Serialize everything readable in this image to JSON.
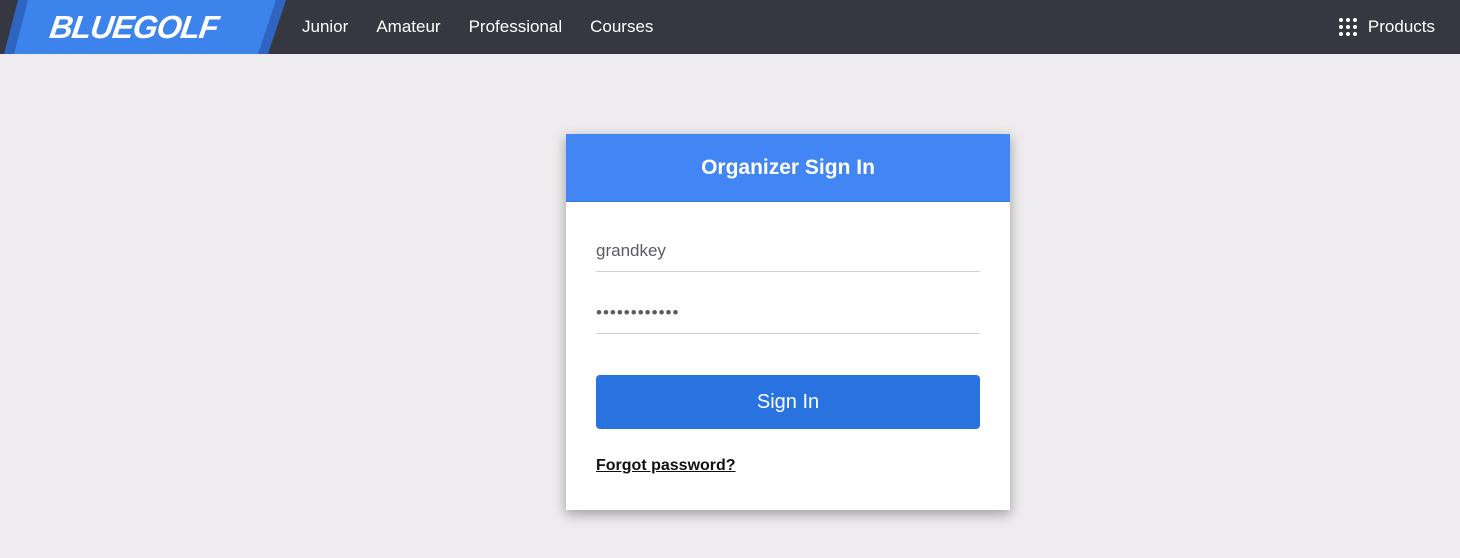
{
  "brand": {
    "name": "BLUEGOLF",
    "accent_color": "#3d83ec",
    "topbar_color": "#353841"
  },
  "nav": {
    "items": [
      {
        "label": "Junior"
      },
      {
        "label": "Amateur"
      },
      {
        "label": "Professional"
      },
      {
        "label": "Courses"
      }
    ],
    "products_label": "Products",
    "products_icon": "grid-icon"
  },
  "signin": {
    "title": "Organizer Sign In",
    "header_color": "#4285f4",
    "username_value": "grandkey",
    "password_value": "••••••••••••",
    "button_label": "Sign In",
    "button_color": "#2873e0",
    "forgot_label": "Forgot password?"
  }
}
